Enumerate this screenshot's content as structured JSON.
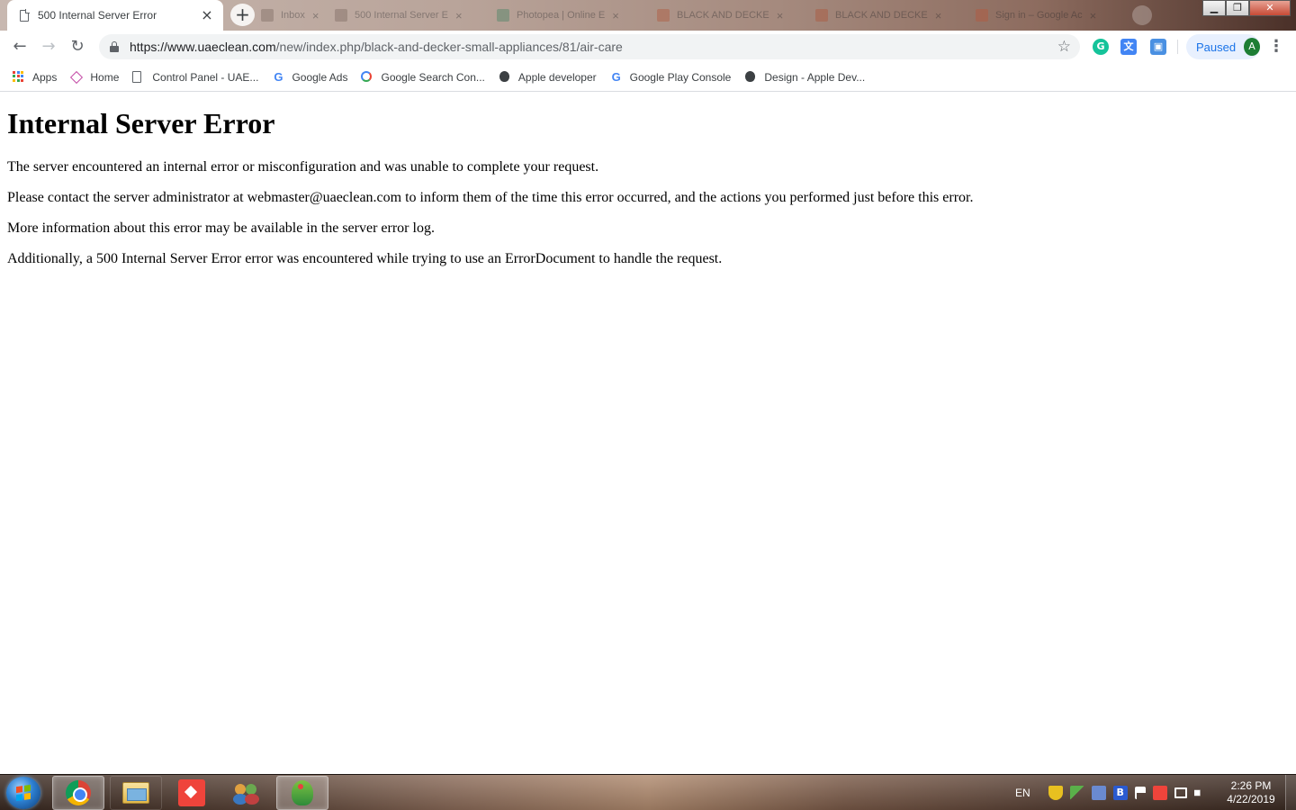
{
  "browser": {
    "active_tab": {
      "title": "500 Internal Server Error",
      "close_glyph": "×"
    },
    "new_tab_glyph": "+",
    "background_tabs": [
      {
        "title": "Inbox"
      },
      {
        "title": "500 Internal Server E"
      },
      {
        "title": "Photopea | Online E"
      },
      {
        "title": "BLACK AND DECKE"
      },
      {
        "title": "BLACK AND DECKE"
      },
      {
        "title": "Sign in – Google Ac"
      }
    ],
    "window_controls": {
      "minimize": "▁",
      "maximize": "❐",
      "close": "✕"
    },
    "toolbar": {
      "back_glyph": "←",
      "forward_glyph": "→",
      "reload_glyph": "↻",
      "url_host": "https://www.uaeclean.com",
      "url_path": "/new/index.php/black-and-decker-small-appliances/81/air-care",
      "star_glyph": "☆",
      "extensions": [
        {
          "name": "grammarly-icon",
          "glyph": "G",
          "color": "#15c39a"
        },
        {
          "name": "google-translate-icon",
          "glyph": "文",
          "color": "#4285f4"
        },
        {
          "name": "extension-icon",
          "glyph": "▣",
          "color": "#4a90e2"
        }
      ],
      "profile": {
        "status": "Paused",
        "avatar_letter": "A"
      },
      "menu_glyph": "⋮"
    },
    "bookmarks": [
      {
        "name": "bookmark-apps",
        "label": "Apps",
        "icon": "apps-grid-icon"
      },
      {
        "name": "bookmark-home",
        "label": "Home",
        "icon": "diamond-icon"
      },
      {
        "name": "bookmark-control-panel",
        "label": "Control Panel - UAE...",
        "icon": "page-icon"
      },
      {
        "name": "bookmark-google-ads",
        "label": "Google Ads",
        "icon": "google-icon"
      },
      {
        "name": "bookmark-search-console",
        "label": "Google Search Con...",
        "icon": "search-console-icon"
      },
      {
        "name": "bookmark-apple-developer",
        "label": "Apple developer",
        "icon": "apple-icon"
      },
      {
        "name": "bookmark-play-console",
        "label": "Google Play Console",
        "icon": "google-icon"
      },
      {
        "name": "bookmark-design-apple",
        "label": "Design - Apple Dev...",
        "icon": "apple-icon"
      }
    ]
  },
  "page": {
    "heading": "Internal Server Error",
    "paragraphs": [
      "The server encountered an internal error or misconfiguration and was unable to complete your request.",
      "Please contact the server administrator at webmaster@uaeclean.com to inform them of the time this error occurred, and the actions you performed just before this error.",
      "More information about this error may be available in the server error log.",
      "Additionally, a 500 Internal Server Error error was encountered while trying to use an ErrorDocument to handle the request."
    ]
  },
  "taskbar": {
    "apps": [
      {
        "name": "taskbar-chrome",
        "icon": "chrome-icon",
        "active": true
      },
      {
        "name": "taskbar-file-explorer",
        "icon": "folder-icon",
        "active": false
      },
      {
        "name": "taskbar-anydesk",
        "icon": "anydesk-icon",
        "active": false
      },
      {
        "name": "taskbar-contacts",
        "icon": "people-icon",
        "active": false
      },
      {
        "name": "taskbar-parrot-app",
        "icon": "parrot-icon",
        "active": true
      }
    ],
    "tray": {
      "language": "EN",
      "icons": [
        {
          "name": "security-shield-icon",
          "color": "#e8c020"
        },
        {
          "name": "pen-tool-icon",
          "color": "#5ab04a"
        },
        {
          "name": "sync-app-icon",
          "color": "#6a8ad0"
        },
        {
          "name": "b-app-icon",
          "color": "#2a5ad0"
        },
        {
          "name": "action-center-flag-icon",
          "color": "#ffffff"
        },
        {
          "name": "anydesk-tray-icon",
          "color": "#ef443b"
        },
        {
          "name": "network-icon",
          "color": "#ffffff"
        },
        {
          "name": "volume-muted-icon",
          "color": "#ffffff"
        }
      ],
      "time": "2:26 PM",
      "date": "4/22/2019"
    }
  }
}
